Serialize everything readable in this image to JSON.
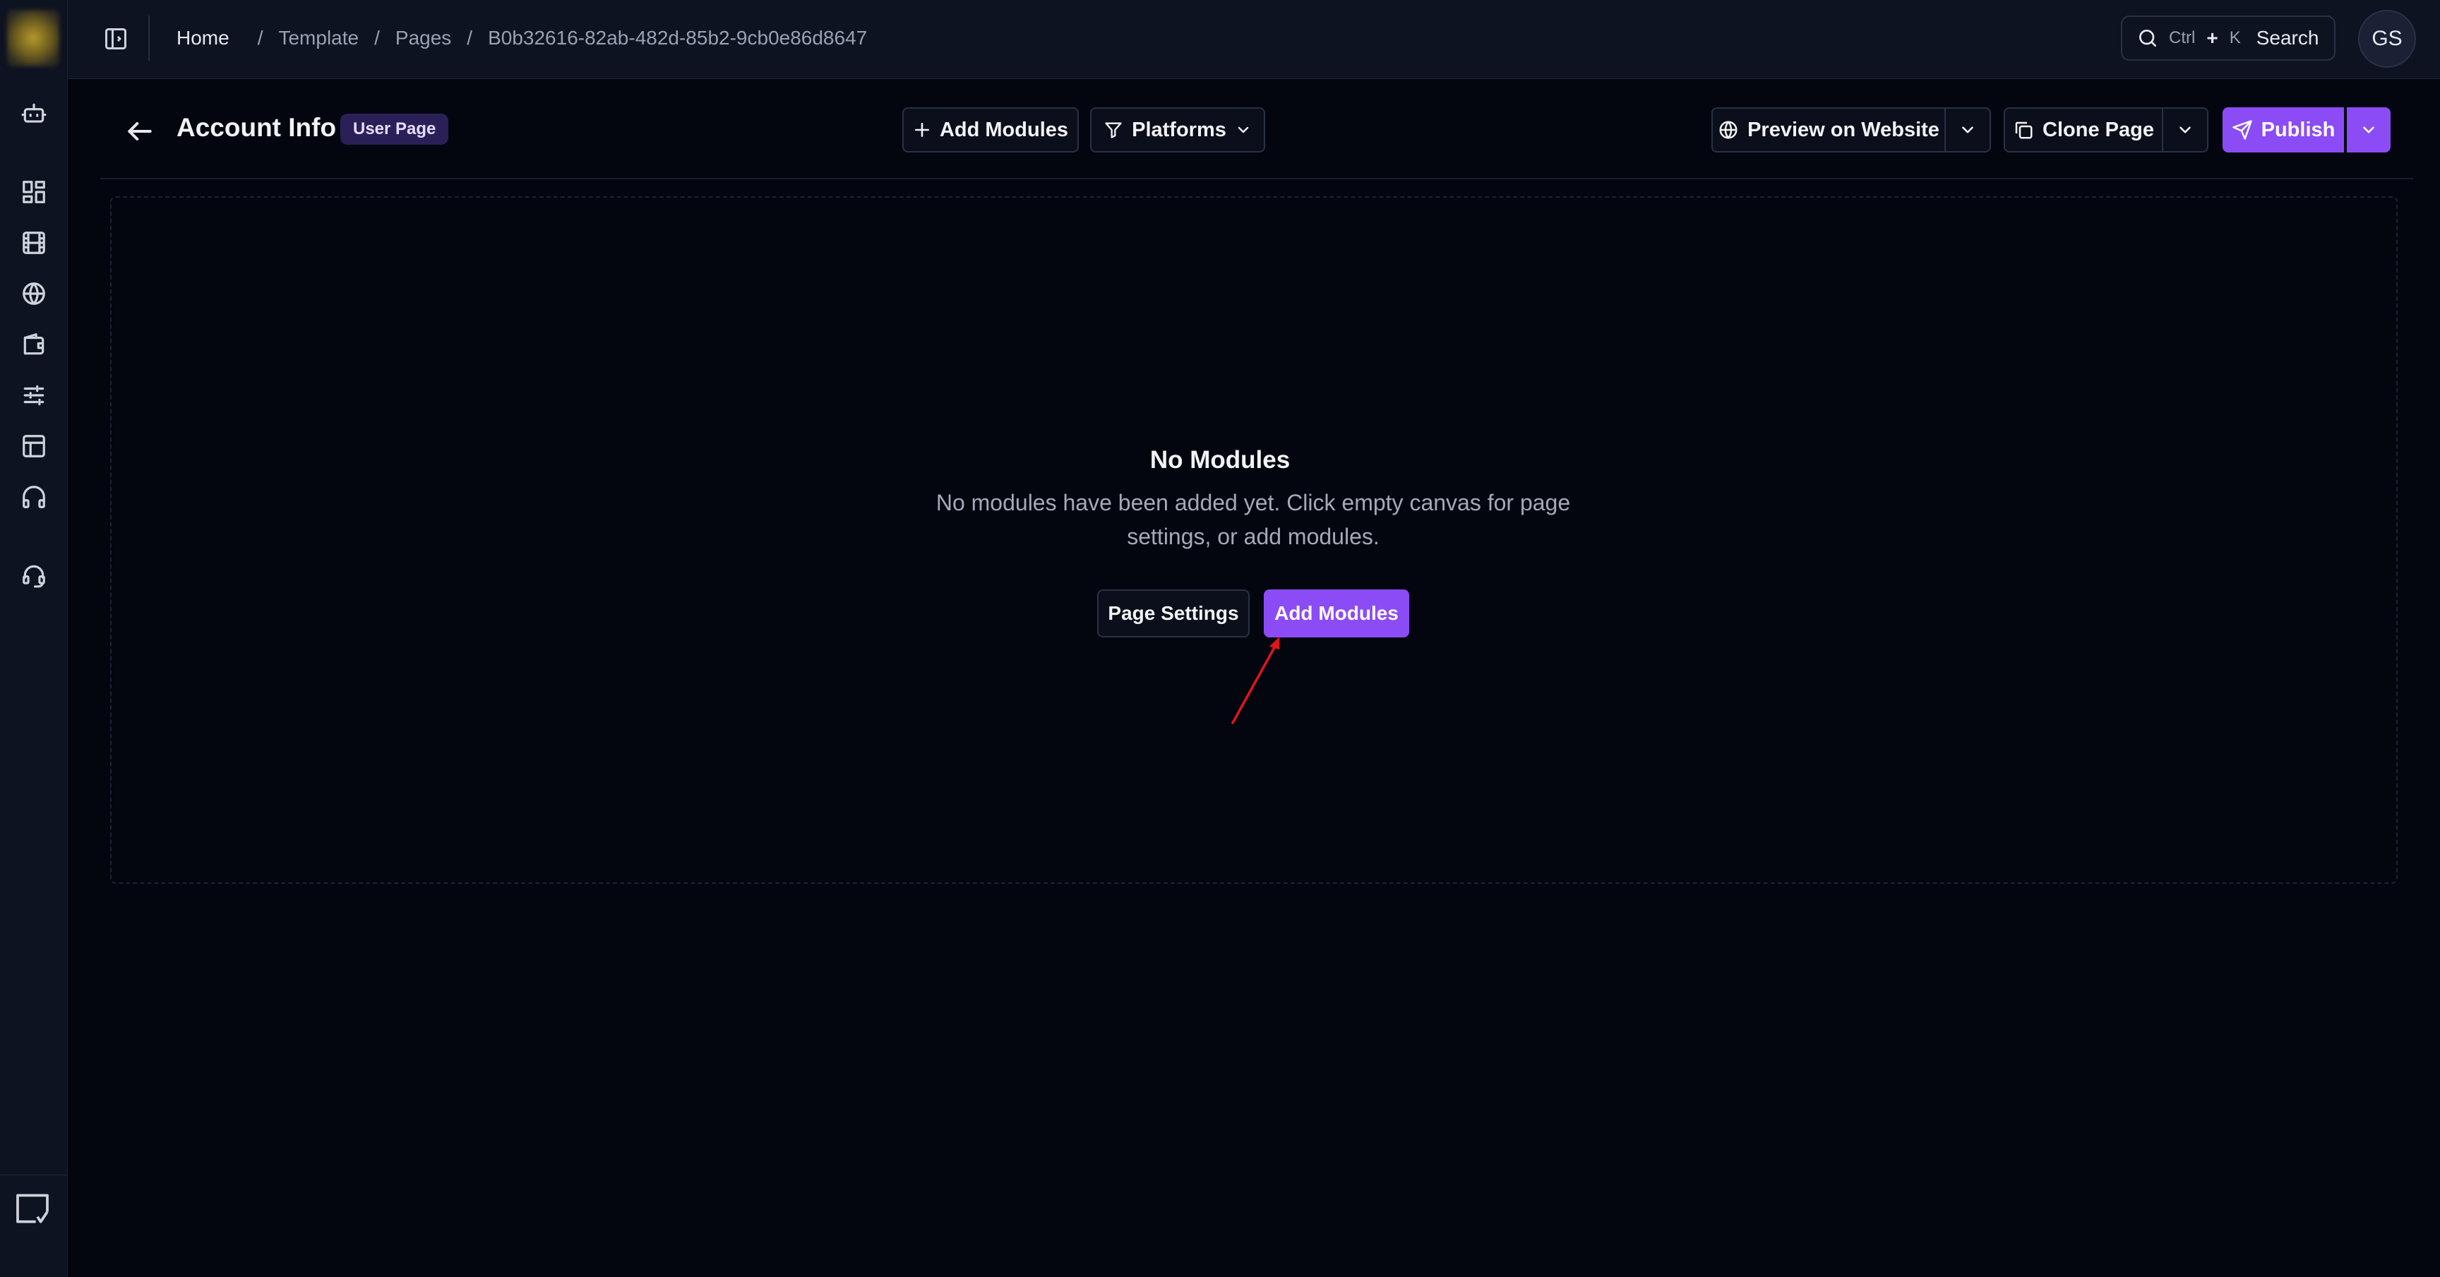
{
  "topbar": {
    "breadcrumbs": [
      "Home",
      "Template",
      "Pages",
      "B0b32616-82ab-482d-85b2-9cb0e86d8647"
    ],
    "search": {
      "kbd_ctrl": "Ctrl",
      "kbd_plus": "+",
      "kbd_k": "K",
      "label": "Search"
    },
    "avatar_initials": "GS"
  },
  "rail": {
    "icons": [
      "bot-icon",
      "dashboard-icon",
      "film-icon",
      "globe-icon",
      "wallet-icon",
      "sliders-icon",
      "layout-icon",
      "headphones-icon",
      "headset-icon",
      "screenshot-icon"
    ]
  },
  "header": {
    "title": "Account Info",
    "badge": "User Page",
    "add_modules_label": "Add Modules",
    "platforms_label": "Platforms",
    "preview_label": "Preview on Website",
    "clone_label": "Clone Page",
    "publish_label": "Publish"
  },
  "canvas": {
    "empty_title": "No Modules",
    "empty_description": "No modules have been added yet. Click empty canvas for page settings, or add modules.",
    "page_settings_label": "Page Settings",
    "add_modules_label": "Add Modules"
  },
  "colors": {
    "accent": "#8b4cf6",
    "background": "#03060f",
    "panel": "#0e1322",
    "annotation_arrow": "#e0151b"
  }
}
